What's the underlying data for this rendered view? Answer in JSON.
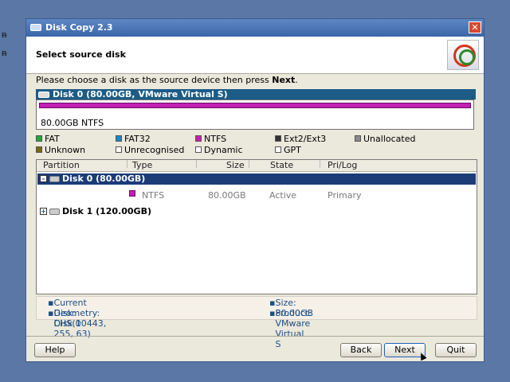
{
  "window": {
    "title": "Disk Copy 2.3",
    "close_glyph": "✕"
  },
  "header": {
    "title": "Select source disk"
  },
  "instruction": {
    "text": "Please choose a disk as the source device then press ",
    "bold": "Next",
    "end": "."
  },
  "selected_disk": {
    "label": "Disk 0 (80.00GB, VMware Virtual S)",
    "map_label": "80.00GB NTFS",
    "map_color": "#c21fb4"
  },
  "legend": [
    {
      "label": "FAT",
      "color": "#20a83a"
    },
    {
      "label": "FAT32",
      "color": "#1b86c9"
    },
    {
      "label": "NTFS",
      "color": "#c21fb4"
    },
    {
      "label": "Ext2/Ext3",
      "color": "#333333"
    },
    {
      "label": "Unallocated",
      "color": "#8a8a8a"
    },
    {
      "label": "Unknown",
      "color": "#7a6a10"
    },
    {
      "label": "Unrecognised",
      "color": "#ffffff"
    },
    {
      "label": "Dynamic",
      "color": "#ffffff"
    },
    {
      "label": "GPT",
      "color": "#ffffff"
    }
  ],
  "grid": {
    "columns": [
      "Partition",
      "Type",
      "Size",
      "State",
      "Pri/Log"
    ],
    "disks": [
      {
        "label": "Disk 0 (80.00GB)",
        "toggle": "–",
        "partitions": [
          {
            "type": "NTFS",
            "size": "80.00GB",
            "state": "Active",
            "prilog": "Primary"
          }
        ]
      },
      {
        "label": "Disk 1 (120.00GB)",
        "toggle": "+"
      }
    ]
  },
  "info": {
    "current_disk": "Current Disk: Disk 0",
    "geometry": "Geometry: CHS(10443, 255, 63)",
    "size": "Size: 80.00GB",
    "product": "Product: VMware Virtual S"
  },
  "buttons": {
    "help": "Help",
    "back": "Back",
    "next": "Next",
    "quit": "Quit"
  },
  "colors": {
    "title_bar": "#3b66a8",
    "selection": "#1c3c78",
    "info_text": "#1c4f86"
  }
}
